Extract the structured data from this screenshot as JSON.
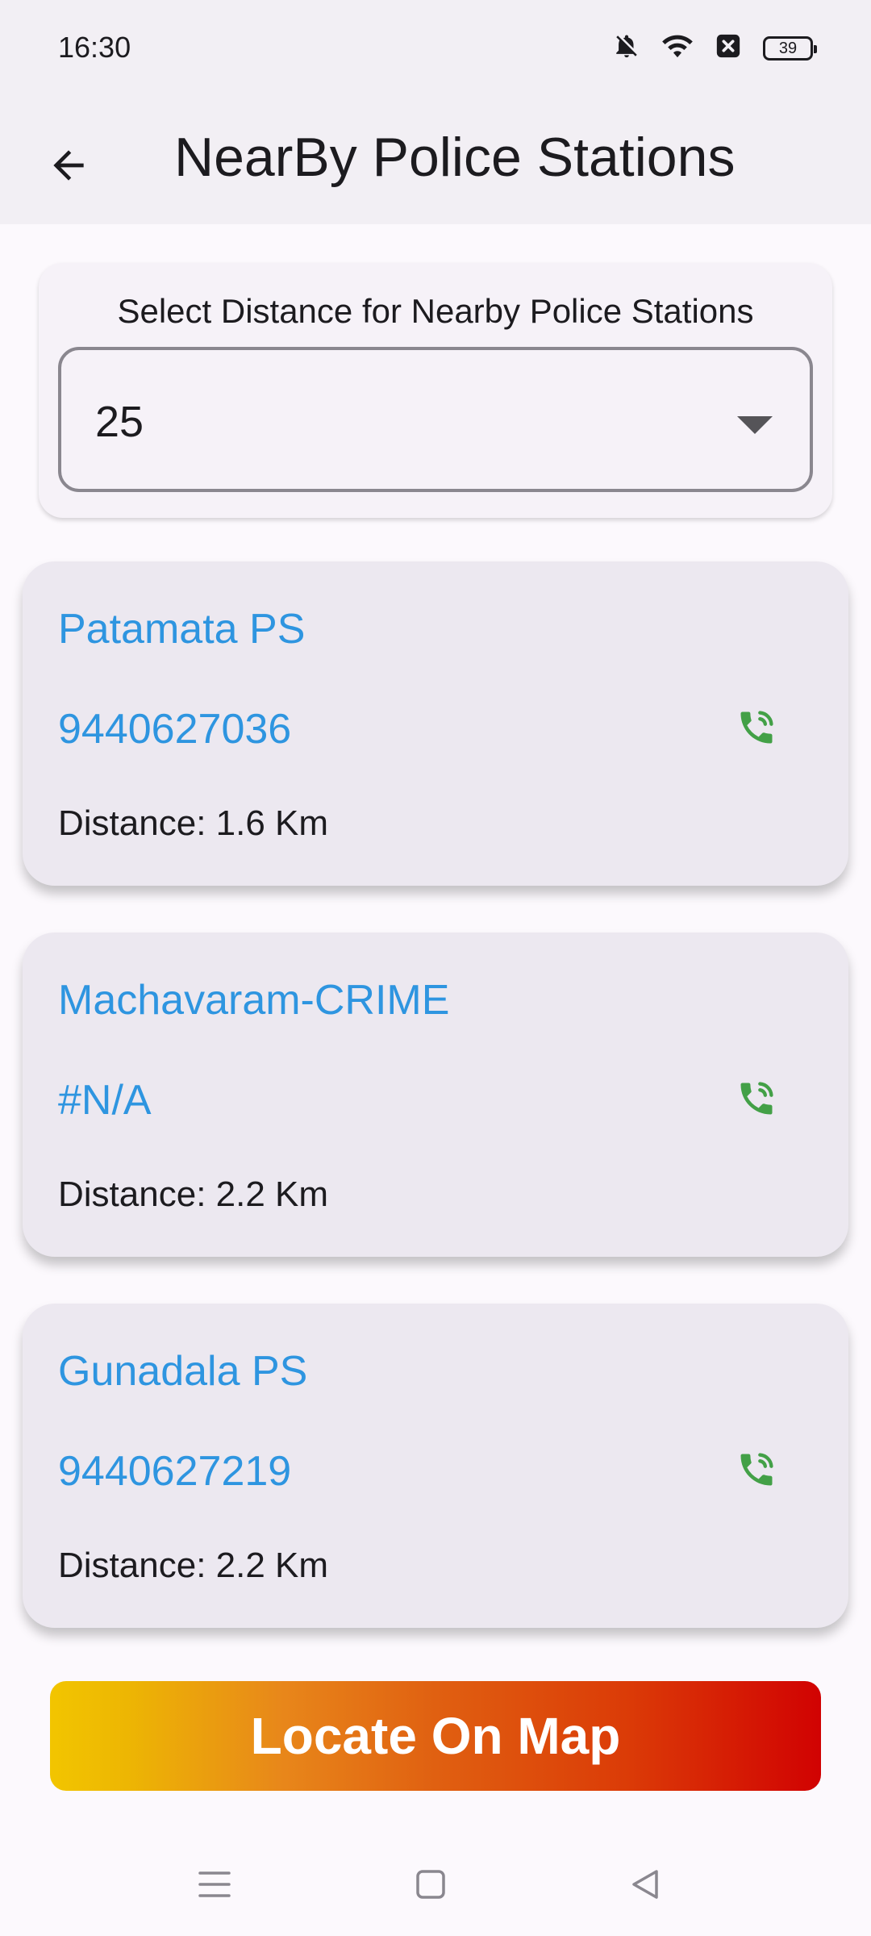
{
  "status_bar": {
    "time": "16:30",
    "battery": "39",
    "icons": [
      "bell-off-icon",
      "wifi-icon",
      "data-off-icon",
      "battery-icon"
    ]
  },
  "app_bar": {
    "back_icon": "arrow-left-icon",
    "title": "NearBy Police Stations"
  },
  "distance_selector": {
    "label": "Select Distance for Nearby Police Stations",
    "selected_value": "25"
  },
  "stations": [
    {
      "name": "Patamata PS",
      "phone": "9440627036",
      "distance": "Distance: 1.6 Km"
    },
    {
      "name": "Machavaram-CRIME",
      "phone": "#N/A",
      "distance": "Distance: 2.2 Km"
    },
    {
      "name": "Gunadala PS",
      "phone": "9440627219",
      "distance": "Distance: 2.2 Km"
    }
  ],
  "actions": {
    "locate_label": "Locate On Map"
  },
  "colors": {
    "accent_blue": "#2e95e0",
    "call_green": "#43a047",
    "gradient_start": "#f2c500",
    "gradient_end": "#d10202"
  },
  "nav_bar": {
    "icons": [
      "menu-icon",
      "home-icon",
      "back-triangle-icon"
    ]
  }
}
